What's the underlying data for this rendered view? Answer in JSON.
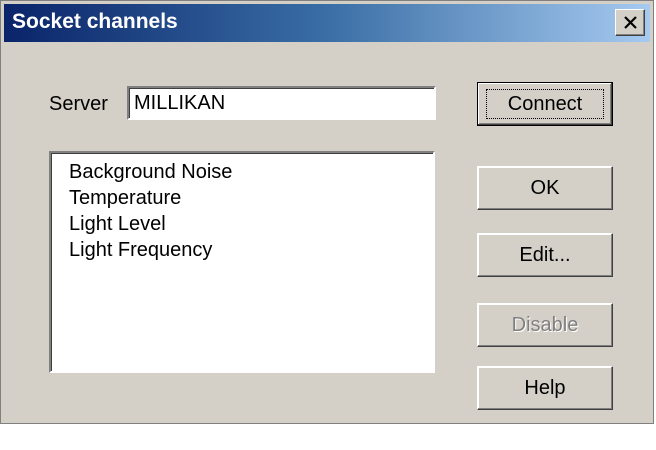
{
  "window": {
    "title": "Socket channels",
    "close_icon": "close-x-icon"
  },
  "server": {
    "label": "Server",
    "value": "MILLIKAN"
  },
  "channels": {
    "items": [
      "Background Noise",
      "Temperature",
      "Light Level",
      "Light Frequency"
    ]
  },
  "buttons": {
    "connect": "Connect",
    "ok": "OK",
    "edit": "Edit...",
    "disable": "Disable",
    "help": "Help"
  }
}
